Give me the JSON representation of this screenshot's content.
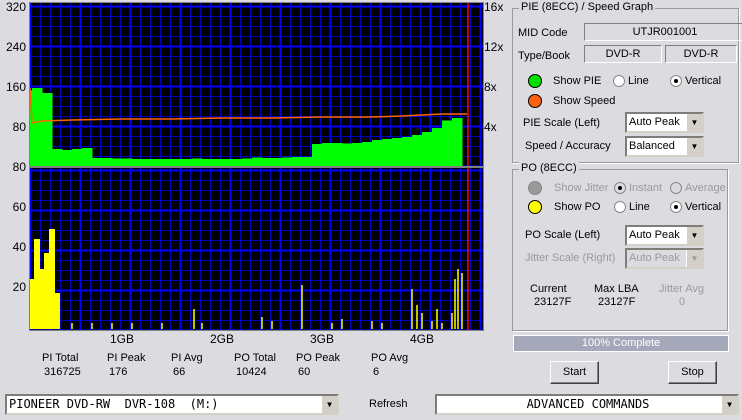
{
  "pie_chart": {
    "left_ticks": [
      "320",
      "240",
      "160",
      "80"
    ],
    "bottom_label": "80",
    "right_ticks": [
      "16x",
      "12x",
      "8x",
      "4x"
    ],
    "colors": {
      "pie": "#00ff00",
      "speed": "#ff6600",
      "grid": "#0000ff",
      "marker": "#ff0000"
    }
  },
  "po_chart": {
    "left_ticks": [
      "60",
      "40",
      "20"
    ],
    "x_ticks": [
      "1GB",
      "2GB",
      "3GB",
      "4GB"
    ],
    "color": "#ffff00"
  },
  "chart_data": [
    {
      "type": "bar",
      "name_hint": "PIE",
      "xunit": "GB",
      "ylim": [
        0,
        320
      ],
      "x": [
        0.1,
        0.2,
        0.3,
        0.4,
        0.5,
        0.6,
        0.7,
        0.8,
        0.9,
        1.0,
        1.1,
        1.2,
        1.3,
        1.4,
        1.5,
        1.6,
        1.7,
        1.8,
        1.9,
        2.0,
        2.1,
        2.2,
        2.3,
        2.4,
        2.5,
        2.6,
        2.7,
        2.8,
        2.9,
        3.0,
        3.1,
        3.2,
        3.3,
        3.4,
        3.5,
        3.6,
        3.7,
        3.8,
        3.9,
        4.0,
        4.1,
        4.2,
        4.3,
        4.4
      ],
      "values": [
        155,
        160,
        150,
        38,
        36,
        38,
        40,
        20,
        20,
        19,
        19,
        18,
        18,
        18,
        18,
        18,
        18,
        19,
        18,
        18,
        18,
        18,
        19,
        21,
        20,
        20,
        21,
        22,
        22,
        48,
        50,
        50,
        49,
        50,
        52,
        56,
        58,
        60,
        62,
        66,
        72,
        80,
        95,
        100
      ]
    },
    {
      "type": "line",
      "name_hint": "Speed",
      "yunit": "x",
      "ylim": [
        0,
        16
      ],
      "x": [
        0.08,
        0.1,
        0.2,
        0.5,
        1.0,
        1.5,
        2.0,
        2.5,
        3.0,
        3.5,
        3.8,
        4.2,
        4.45
      ],
      "values": [
        8,
        4.5,
        4.7,
        4.8,
        4.9,
        4.9,
        5.0,
        5.0,
        5.1,
        5.1,
        5.2,
        5.4,
        5.4
      ]
    },
    {
      "type": "bar",
      "name_hint": "PO",
      "xunit": "GB",
      "ylim": [
        0,
        80
      ],
      "x": [
        0.1,
        0.15,
        0.2,
        0.25,
        0.3,
        0.35,
        0.5,
        0.7,
        0.9,
        1.1,
        1.4,
        1.72,
        1.8,
        2.4,
        2.5,
        2.8,
        3.1,
        3.2,
        3.5,
        3.6,
        3.9,
        3.95,
        4.0,
        4.1,
        4.15,
        4.2,
        4.3,
        4.33,
        4.36,
        4.4
      ],
      "values": [
        25,
        45,
        30,
        38,
        50,
        18,
        3,
        3,
        3,
        3,
        3,
        10,
        3,
        6,
        4,
        22,
        3,
        5,
        4,
        3,
        20,
        12,
        8,
        4,
        10,
        3,
        8,
        25,
        30,
        28
      ]
    }
  ],
  "stats": [
    {
      "label": "PI Total",
      "value": "316725"
    },
    {
      "label": "PI Peak",
      "value": "176"
    },
    {
      "label": "PI Avg",
      "value": "66"
    },
    {
      "label": "PO Total",
      "value": "10424"
    },
    {
      "label": "PO Peak",
      "value": "60"
    },
    {
      "label": "PO Avg",
      "value": "6"
    }
  ],
  "pie_group": {
    "title": "PIE (8ECC) / Speed Graph",
    "mid_label": "MID Code",
    "mid_value": "UTJR001001",
    "type_label": "Type/Book",
    "type_value": "DVD-R",
    "book_value": "DVD-R",
    "show_pie": "Show PIE",
    "line": "Line",
    "vertical": "Vertical",
    "show_speed": "Show Speed",
    "scale_label": "PIE Scale (Left)",
    "scale_value": "Auto Peak",
    "speed_label": "Speed / Accuracy",
    "speed_value": "Balanced"
  },
  "po_group": {
    "title": "PO (8ECC)",
    "show_jitter": "Show Jitter",
    "instant": "Instant",
    "average": "Average",
    "show_po": "Show PO",
    "line": "Line",
    "vertical": "Vertical",
    "scale_label": "PO Scale (Left)",
    "scale_value": "Auto Peak",
    "jitter_label": "Jitter Scale (Right)",
    "jitter_value": "Auto Peak",
    "current_label": "Current",
    "current_value": "23127F",
    "maxlba_label": "Max LBA",
    "maxlba_value": "23127F",
    "jitteravg_label": "Jitter Avg",
    "jitteravg_value": "0"
  },
  "progress": {
    "label": "100% Complete",
    "percent": 100
  },
  "buttons": {
    "start": "Start",
    "stop": "Stop",
    "refresh": "Refresh"
  },
  "drive": "PIONEER DVD-RW  DVR-108  (M:)",
  "advanced": "ADVANCED COMMANDS"
}
